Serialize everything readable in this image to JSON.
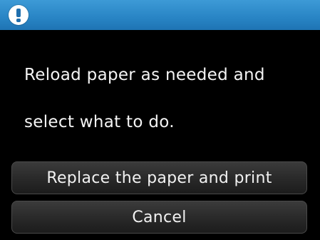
{
  "header": {
    "icon": "alert-icon",
    "background": "#2a86c6"
  },
  "message": {
    "line1": "Reload paper as needed and",
    "line2": "select what to do."
  },
  "buttons": {
    "replace_label": "Replace the paper and print",
    "cancel_label": "Cancel"
  }
}
